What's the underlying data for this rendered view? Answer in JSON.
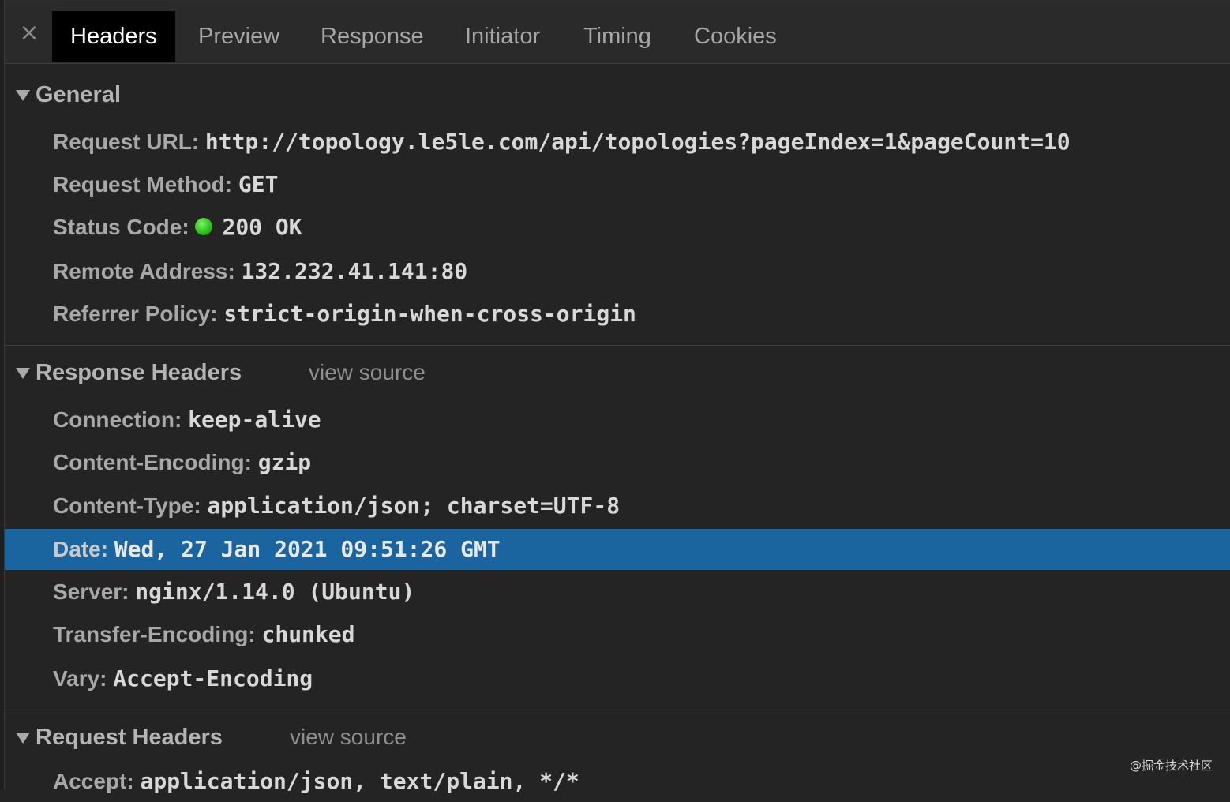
{
  "tabs": [
    {
      "label": "Headers",
      "active": true
    },
    {
      "label": "Preview"
    },
    {
      "label": "Response"
    },
    {
      "label": "Initiator"
    },
    {
      "label": "Timing"
    },
    {
      "label": "Cookies"
    }
  ],
  "close_icon": "×",
  "general": {
    "title": "General",
    "rows": [
      {
        "key": "Request URL:",
        "value": "http://topology.le5le.com/api/topologies?pageIndex=1&pageCount=10"
      },
      {
        "key": "Request Method:",
        "value": "GET"
      },
      {
        "key": "Status Code:",
        "value": "200 OK"
      },
      {
        "key": "Remote Address:",
        "value": "132.232.41.141:80"
      },
      {
        "key": "Referrer Policy:",
        "value": "strict-origin-when-cross-origin"
      }
    ]
  },
  "response_headers": {
    "title": "Response Headers",
    "view_source": "view source",
    "rows": [
      {
        "key": "Connection:",
        "value": "keep-alive"
      },
      {
        "key": "Content-Encoding:",
        "value": "gzip"
      },
      {
        "key": "Content-Type:",
        "value": "application/json; charset=UTF-8"
      },
      {
        "key": "Date:",
        "value": "Wed, 27 Jan 2021 09:51:26 GMT"
      },
      {
        "key": "Server:",
        "value": "nginx/1.14.0 (Ubuntu)"
      },
      {
        "key": "Transfer-Encoding:",
        "value": "chunked"
      },
      {
        "key": "Vary:",
        "value": "Accept-Encoding"
      }
    ]
  },
  "request_headers": {
    "title": "Request Headers",
    "view_source": "view source",
    "rows": [
      {
        "key": "Accept:",
        "value": "application/json, text/plain, */*"
      }
    ]
  },
  "colors": {
    "selected_row": "#1a65a0",
    "status_ok": "#2ec31d"
  },
  "watermark": "@掘金技术社区"
}
